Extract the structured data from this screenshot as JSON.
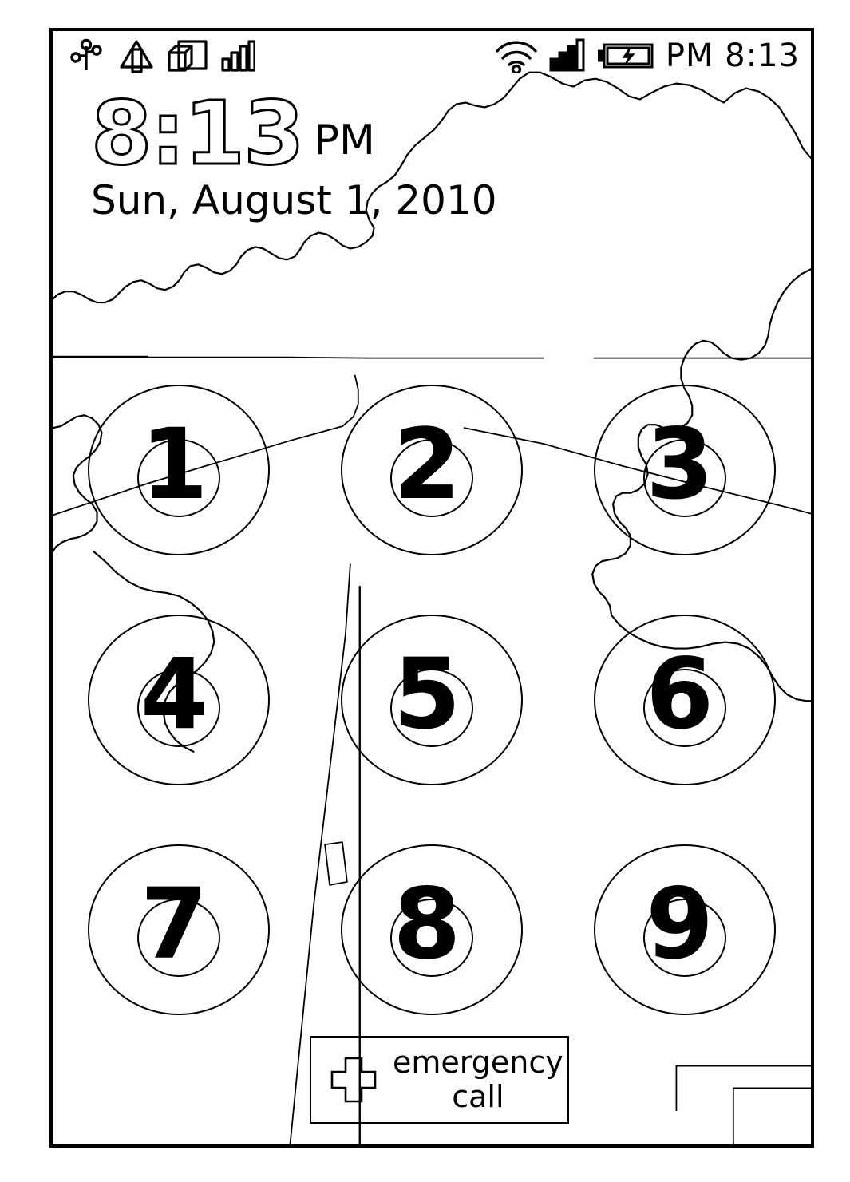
{
  "device": {
    "screen_label": "phone-lock-screen"
  },
  "status_bar": {
    "left_icons": [
      {
        "name": "usb-debugging-icon",
        "glyph": "usb"
      },
      {
        "name": "download-alert-icon",
        "glyph": "triangle-bar"
      },
      {
        "name": "sd-card-icon",
        "glyph": "cube-box"
      },
      {
        "name": "signal-bars-outline-icon",
        "glyph": "bars-outline"
      }
    ],
    "right_icons": [
      {
        "name": "wifi-icon",
        "glyph": "wifi"
      },
      {
        "name": "cellular-signal-icon",
        "glyph": "bars-filled"
      },
      {
        "name": "battery-charging-icon",
        "glyph": "battery-bolt"
      }
    ],
    "clock": "PM 8:13"
  },
  "lock_screen": {
    "time": "8:13",
    "ampm": "PM",
    "date": "Sun, August 1, 2010"
  },
  "keypad": {
    "rows": [
      [
        {
          "digit": "1",
          "name": "keypad-key-1"
        },
        {
          "digit": "2",
          "name": "keypad-key-2"
        },
        {
          "digit": "3",
          "name": "keypad-key-3"
        }
      ],
      [
        {
          "digit": "4",
          "name": "keypad-key-4"
        },
        {
          "digit": "5",
          "name": "keypad-key-5"
        },
        {
          "digit": "6",
          "name": "keypad-key-6"
        }
      ],
      [
        {
          "digit": "7",
          "name": "keypad-key-7"
        },
        {
          "digit": "8",
          "name": "keypad-key-8"
        },
        {
          "digit": "9",
          "name": "keypad-key-9"
        }
      ]
    ]
  },
  "emergency": {
    "icon": "cross-icon",
    "label_line1": "emergency",
    "label_line2": "call"
  },
  "colors": {
    "ink": "#000000",
    "background": "#ffffff"
  }
}
